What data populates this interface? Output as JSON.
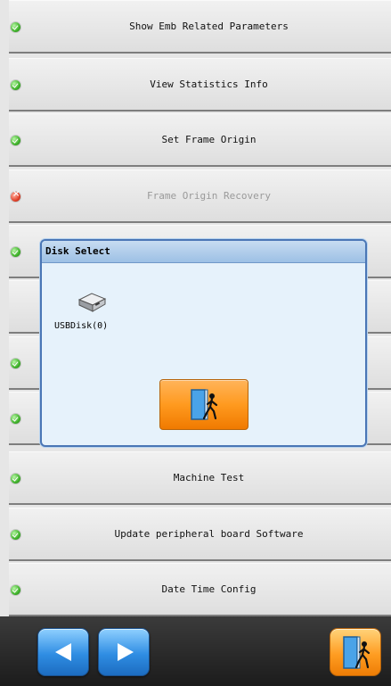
{
  "menu": {
    "items": [
      {
        "label": "Show Emb Related Parameters",
        "status": "ok"
      },
      {
        "label": "View Statistics Info",
        "status": "ok"
      },
      {
        "label": "Set Frame Origin",
        "status": "ok"
      },
      {
        "label": "Frame Origin Recovery",
        "status": "error",
        "disabled": true
      },
      {
        "label": "",
        "status": "ok"
      },
      {
        "label": "",
        "status": "none"
      },
      {
        "label": "",
        "status": "ok"
      },
      {
        "label": "",
        "status": "ok"
      },
      {
        "label": "Machine Test",
        "status": "ok"
      },
      {
        "label": "Update peripheral board Software",
        "status": "ok"
      },
      {
        "label": "Date Time Config",
        "status": "ok"
      }
    ]
  },
  "dialog": {
    "title": "Disk Select",
    "disk": {
      "label": "USBDisk(0)",
      "icon": "usb-disk-icon"
    },
    "exit_icon": "exit-door-icon"
  },
  "bottom_bar": {
    "prev_icon": "left-arrow-icon",
    "next_icon": "right-arrow-icon",
    "exit_icon": "exit-door-icon"
  },
  "colors": {
    "dialog_border": "#4a76b5",
    "accent_orange": "#ff9a1f",
    "nav_blue": "#2f8de3",
    "status_ok": "#3fb22a",
    "status_error": "#e0412a"
  }
}
